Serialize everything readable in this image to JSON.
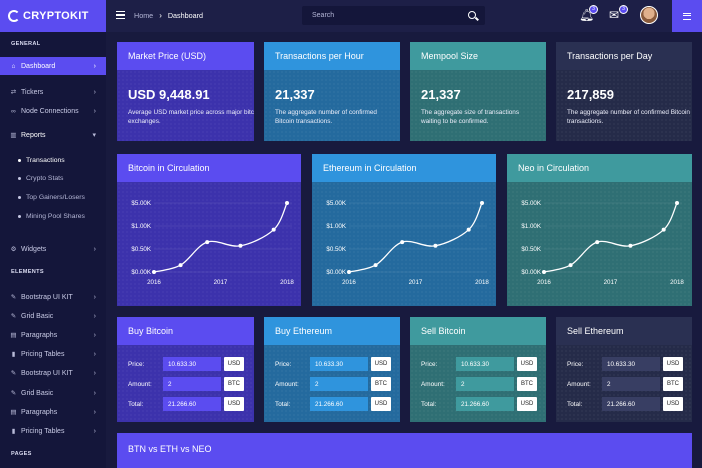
{
  "brand": "CRYPTOKIT",
  "breadcrumb": {
    "home": "Home",
    "current": "Dashboard"
  },
  "search": {
    "placeholder": "Search"
  },
  "notifications": {
    "bell": "3",
    "mail": "3"
  },
  "sidebar": {
    "general": "GENERAL",
    "dashboard": "Dashboard",
    "tickers": "Tickers",
    "node": "Node Connections",
    "reports": "Reports",
    "transactions": "Transactions",
    "crypto_stats": "Crypto Stats",
    "top_gainers": "Top Gainers/Losers",
    "mining": "Mining Pool Shares",
    "widgets": "Widgets",
    "elements": "ELEMENTS",
    "bootstrap1": "Bootstrap UI KIT",
    "grid1": "Grid Basic",
    "paragraphs1": "Paragraphs",
    "pricing1": "Pricing Tables",
    "bootstrap2": "Bootstrap UI KIT",
    "grid2": "Grid Basic",
    "paragraphs2": "Paragraphs",
    "pricing2": "Pricing Tables",
    "pages": "PAGES"
  },
  "stats": [
    {
      "title": "Market Price (USD)",
      "value": "USD 9,448.91",
      "desc": "Average USD market price across major bitcoin exchanges."
    },
    {
      "title": "Transactions per Hour",
      "value": "21,337",
      "desc": "The aggregate number of confirmed Bitcoin transactions."
    },
    {
      "title": "Mempool Size",
      "value": "21,337",
      "desc": "The aggregate size of transactions waiting to be confirmed."
    },
    {
      "title": "Transactions per Day",
      "value": "217,859",
      "desc": "The aggregate number of confirmed Bitcoin transactions."
    }
  ],
  "chart_data": [
    {
      "type": "line",
      "title": "Bitcoin in Circulation",
      "x": [
        2016,
        2016.4,
        2016.8,
        2017.3,
        2017.8,
        2018
      ],
      "y": [
        0,
        0.15,
        0.65,
        0.57,
        0.92,
        1.5
      ],
      "xticks": [
        "2016",
        "2017",
        "2018"
      ],
      "yticks": [
        "$0.00K",
        "$0.50K",
        "$1.00K",
        "$5.00K"
      ]
    },
    {
      "type": "line",
      "title": "Ethereum in Circulation",
      "x": [
        2016,
        2016.4,
        2016.8,
        2017.3,
        2017.8,
        2018
      ],
      "y": [
        0,
        0.15,
        0.65,
        0.57,
        0.92,
        1.5
      ],
      "xticks": [
        "2016",
        "2017",
        "2018"
      ],
      "yticks": [
        "$0.00K",
        "$0.50K",
        "$1.00K",
        "$5.00K"
      ]
    },
    {
      "type": "line",
      "title": "Neo in Circulation",
      "x": [
        2016,
        2016.4,
        2016.8,
        2017.3,
        2017.8,
        2018
      ],
      "y": [
        0,
        0.15,
        0.65,
        0.57,
        0.92,
        1.5
      ],
      "xticks": [
        "2016",
        "2017",
        "2018"
      ],
      "yticks": [
        "$0.00K",
        "$0.50K",
        "$1.00K",
        "$5.00K"
      ]
    }
  ],
  "trade_labels": {
    "price": "Price:",
    "amount": "Amount:",
    "total": "Total:"
  },
  "trades": [
    {
      "title": "Buy Bitcoin",
      "price": "10.633.30",
      "price_cur": "USD",
      "amount": "2",
      "amount_cur": "BTC",
      "total": "21.266.60",
      "total_cur": "USD"
    },
    {
      "title": "Buy Ethereum",
      "price": "10.633.30",
      "price_cur": "USD",
      "amount": "2",
      "amount_cur": "BTC",
      "total": "21.266.60",
      "total_cur": "USD"
    },
    {
      "title": "Sell Bitcoin",
      "price": "10.633.30",
      "price_cur": "USD",
      "amount": "2",
      "amount_cur": "BTC",
      "total": "21.266.60",
      "total_cur": "USD"
    },
    {
      "title": "Sell Ethereum",
      "price": "10.633.30",
      "price_cur": "USD",
      "amount": "2",
      "amount_cur": "BTC",
      "total": "21.266.60",
      "total_cur": "USD"
    }
  ],
  "bottom_title": "BTN vs ETH vs NEO",
  "colors": {
    "accent": "#5b4cf0",
    "blue": "#2f94dd",
    "teal": "#3f9a9e",
    "dark": "#2a3052",
    "bg": "#181a3e"
  }
}
